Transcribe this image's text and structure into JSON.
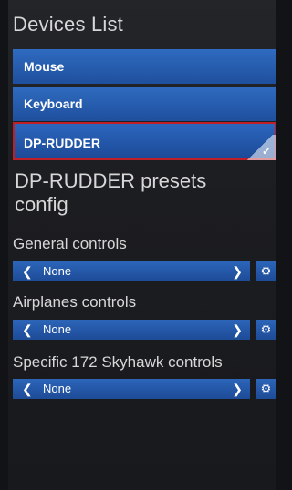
{
  "header": {
    "title": "Devices List"
  },
  "devices": [
    {
      "label": "Mouse",
      "selected": false
    },
    {
      "label": "Keyboard",
      "selected": false
    },
    {
      "label": "DP-RUDDER",
      "selected": true
    }
  ],
  "config": {
    "title": "DP-RUDDER presets config",
    "sections": [
      {
        "label": "General controls",
        "value": "None"
      },
      {
        "label": "Airplanes controls",
        "value": "None"
      },
      {
        "label": "Specific 172 Skyhawk controls",
        "value": "None"
      }
    ]
  },
  "icons": {
    "left": "chevron-left-icon",
    "right": "chevron-right-icon",
    "settings": "gear-icon",
    "check": "check-icon"
  },
  "colors": {
    "background": "#1c1d21",
    "button": "#2a62b6",
    "selected_border": "#c11f27",
    "text": "#d7d7d7"
  }
}
